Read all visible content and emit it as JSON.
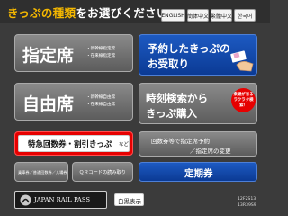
{
  "header": {
    "title_accent": "きっぷの種類",
    "title_rest": "をお選びください",
    "languages": [
      "ENGLISH",
      "簡体中文",
      "繁體中文",
      "한국어"
    ]
  },
  "buttons": {
    "reserved": {
      "label": "指定席",
      "notes": [
        "・新幹線指定席",
        "・在来線指定席"
      ]
    },
    "pickup": {
      "line1": "予約したきっぷの",
      "line2": "お受取り"
    },
    "unreserved": {
      "label": "自由席",
      "notes": [
        "・新幹線自由席",
        "・在来線自由席"
      ]
    },
    "timetable": {
      "line1": "時刻検索から",
      "line2": "きっぷ購入",
      "badge": "乗継が有る ラクラク検索！"
    },
    "coupon": {
      "main": "特急回数券・割引きっぷ",
      "suffix": "など"
    },
    "coupon_change": {
      "line1": "回数券等で指定席予約",
      "line2": "／指定席の変更"
    },
    "platform": {
      "label": "乗車券／普通回数券／入場券"
    },
    "qr": {
      "label": "ＱＲコードの読み取り"
    },
    "commuter": {
      "label": "定期券"
    },
    "jrpass": {
      "label": "JAPAN RAIL PASS"
    },
    "contrast": {
      "label": "白黒表示"
    }
  },
  "footer": {
    "code1": "12F2S13",
    "code2": "13R39S9"
  },
  "colors": {
    "accent": "#f5b800",
    "blue": "#0b3a94",
    "red": "#e60000",
    "gray": "#6e6e6e"
  }
}
